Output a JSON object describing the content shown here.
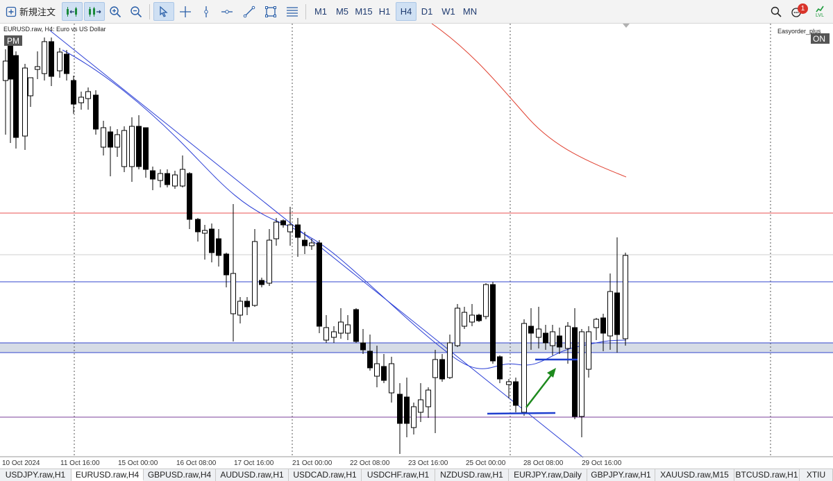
{
  "toolbar": {
    "new_order_label": "新規注文",
    "timeframes": [
      "M1",
      "M5",
      "M15",
      "H1",
      "H4",
      "D1",
      "W1",
      "MN"
    ],
    "active_timeframe": "H4",
    "notification_count": "1",
    "lvl_label": "LVL"
  },
  "chart": {
    "symbol_info": "EURUSD.raw, H4:  Euro vs US Dollar",
    "pm_badge": "PM",
    "indicator_label": "Easyorder_plus",
    "on_badge": "ON",
    "x_labels": [
      "10 Oct 2024",
      "11 Oct 16:00",
      "15 Oct 00:00",
      "16 Oct 08:00",
      "17 Oct 16:00",
      "21 Oct 00:00",
      "22 Oct 08:00",
      "23 Oct 16:00",
      "25 Oct 00:00",
      "28 Oct 08:00",
      "29 Oct 16:00"
    ],
    "colors": {
      "bull_body": "#ffffff",
      "bear_body": "#000000",
      "moving_average": "#2b3fd6",
      "long_ma": "#e04030",
      "red_line": "#e85050",
      "blue_line": "#3344cc",
      "purple_line": "#7a3f9a",
      "zone_fill": "#d6dce6",
      "arrow": "#1e8a1e",
      "support_line": "#1f3fcf"
    }
  },
  "tabs": [
    "USDJPY.raw,H1",
    "EURUSD.raw,H4",
    "GBPUSD.raw,H4",
    "AUDUSD.raw,H1",
    "USDCAD.raw,H1",
    "USDCHF.raw,H1",
    "NZDUSD.raw,H1",
    "EURJPY.raw,Daily",
    "GBPJPY.raw,H1",
    "XAUUSD.raw,M15",
    "BTCUSD.raw,H1",
    "XTIU"
  ],
  "active_tab": "EURUSD.raw,H4"
}
